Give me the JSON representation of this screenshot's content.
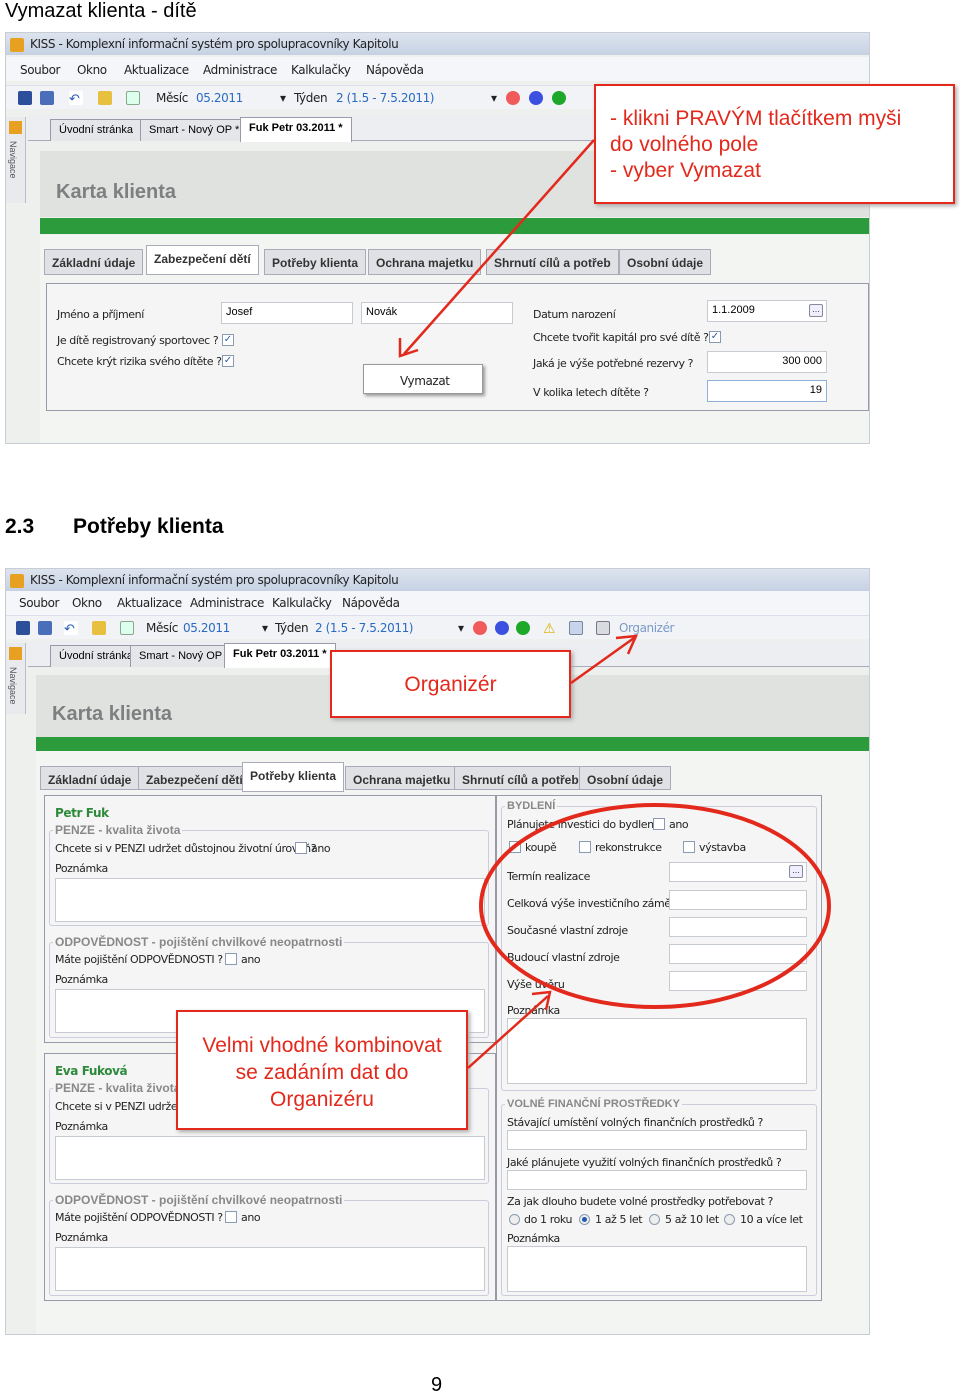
{
  "doc": {
    "top_heading": "Vymazat klienta - dítě",
    "section_number": "2.3",
    "section_title": "Potřeby klienta",
    "page_number": "9"
  },
  "app": {
    "title": "KISS - Komplexní informační systém pro spolupracovníky Kapitolu",
    "menu": [
      "Soubor",
      "Okno",
      "Aktualizace",
      "Administrace",
      "Kalkulačky",
      "Nápověda"
    ],
    "toolbar": {
      "month_label": "Měsíc",
      "month_value": "05.2011",
      "week_label": "Týden",
      "week_value": "2 (1.5 - 7.5.2011)",
      "organizer": "Organizér"
    },
    "doc_tabs": [
      "Úvodní stránka",
      "Smart - Nový OP *",
      "Fuk Petr 03.2011 *"
    ],
    "nav_label": "Navigace",
    "header": "Karta klienta",
    "form_tabs": [
      "Základní údaje",
      "Zabezpečení dětí",
      "Potřeby klienta",
      "Ochrana majetku",
      "Shrnutí cílů a potřeb",
      "Osobní údaje"
    ],
    "colors": {
      "accent_green": "#2c9b3c",
      "callout_red": "#e2291c"
    }
  },
  "shot1": {
    "name_label": "Jméno a příjmení",
    "first_name": "Josef",
    "last_name": "Novák",
    "sport_label": "Je dítě registrovaný sportovec ?",
    "sport_checked": true,
    "risk_label": "Chcete krýt rizika svého dítěte ?",
    "risk_checked": true,
    "birth_label": "Datum narození",
    "birth_value": "1.1.2009",
    "capital_label": "Chcete tvořit kapitál pro své dítě ?",
    "capital_checked": true,
    "reserve_label": "Jaká je výše potřebné rezervy ?",
    "reserve_value": "300 000",
    "age_label": "V kolika letech dítěte ?",
    "age_value": "19",
    "context_menu": "Vymazat",
    "callout": [
      "- klikni PRAVÝM tlačítkem myši",
      "do volného pole",
      "- vyber Vymazat"
    ]
  },
  "shot2": {
    "callout_organizer": "Organizér",
    "callout_combo": [
      "Velmi vhodné kombinovat",
      "se zadáním dat do",
      "Organizéru"
    ],
    "persons": [
      {
        "name": "Petr Fuk",
        "pension_group": "PENZE - kvalita života",
        "pension_q": "Chcete si v PENZI udržet důstojnou životní úroveň?",
        "yes": "ano",
        "note": "Poznámka",
        "liab_group": "ODPOVĚDNOST - pojištění chvilkové neopatrnosti",
        "liab_q": "Máte pojištění ODPOVĚDNOSTI ?"
      },
      {
        "name": "Eva Fuková",
        "pension_group": "PENZE - kvalita života",
        "pension_q": "Chcete si v PENZI udržet důstojnou životní úroveň?",
        "yes": "ano",
        "note": "Poznámka",
        "liab_group": "ODPOVĚDNOST - pojištění chvilkové neopatrnosti",
        "liab_q": "Máte pojištění ODPOVĚDNOSTI ?"
      }
    ],
    "housing": {
      "group": "BYDLENÍ",
      "plan_q": "Plánujete investici do bydlení ?",
      "yes": "ano",
      "options": [
        "koupě",
        "rekonstrukce",
        "výstavba"
      ],
      "fields": [
        "Termín realizace",
        "Celková výše investičního záměru",
        "Současné vlastní zdroje",
        "Budoucí vlastní zdroje",
        "Výše úvěru"
      ],
      "note": "Poznámka"
    },
    "funds": {
      "group": "VOLNÉ FINANČNÍ PROSTŘEDKY",
      "q1": "Stávající umístění volných finančních prostředků ?",
      "q2": "Jaké plánujete využití volných finančních prostředků ?",
      "q3": "Za jak dlouho budete volné prostředky potřebovat ?",
      "options": [
        "do 1 roku",
        "1 až 5 let",
        "5 až 10 let",
        "10 a více let"
      ],
      "selected": "1 až 5 let",
      "note": "Poznámka"
    }
  }
}
